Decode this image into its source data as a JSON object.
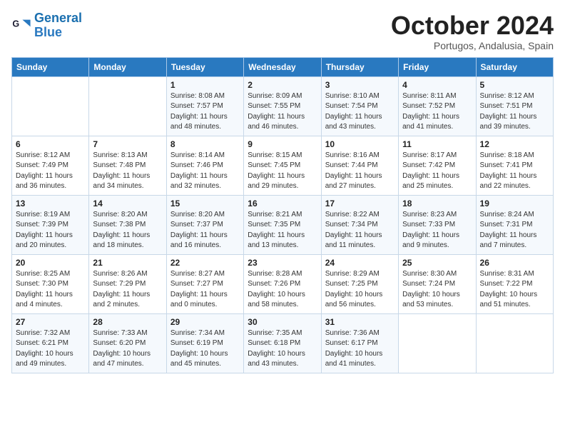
{
  "header": {
    "logo_line1": "General",
    "logo_line2": "Blue",
    "month_title": "October 2024",
    "location": "Portugos, Andalusia, Spain"
  },
  "weekdays": [
    "Sunday",
    "Monday",
    "Tuesday",
    "Wednesday",
    "Thursday",
    "Friday",
    "Saturday"
  ],
  "weeks": [
    [
      {
        "day": "",
        "sunrise": "",
        "sunset": "",
        "daylight": ""
      },
      {
        "day": "",
        "sunrise": "",
        "sunset": "",
        "daylight": ""
      },
      {
        "day": "1",
        "sunrise": "Sunrise: 8:08 AM",
        "sunset": "Sunset: 7:57 PM",
        "daylight": "Daylight: 11 hours and 48 minutes."
      },
      {
        "day": "2",
        "sunrise": "Sunrise: 8:09 AM",
        "sunset": "Sunset: 7:55 PM",
        "daylight": "Daylight: 11 hours and 46 minutes."
      },
      {
        "day": "3",
        "sunrise": "Sunrise: 8:10 AM",
        "sunset": "Sunset: 7:54 PM",
        "daylight": "Daylight: 11 hours and 43 minutes."
      },
      {
        "day": "4",
        "sunrise": "Sunrise: 8:11 AM",
        "sunset": "Sunset: 7:52 PM",
        "daylight": "Daylight: 11 hours and 41 minutes."
      },
      {
        "day": "5",
        "sunrise": "Sunrise: 8:12 AM",
        "sunset": "Sunset: 7:51 PM",
        "daylight": "Daylight: 11 hours and 39 minutes."
      }
    ],
    [
      {
        "day": "6",
        "sunrise": "Sunrise: 8:12 AM",
        "sunset": "Sunset: 7:49 PM",
        "daylight": "Daylight: 11 hours and 36 minutes."
      },
      {
        "day": "7",
        "sunrise": "Sunrise: 8:13 AM",
        "sunset": "Sunset: 7:48 PM",
        "daylight": "Daylight: 11 hours and 34 minutes."
      },
      {
        "day": "8",
        "sunrise": "Sunrise: 8:14 AM",
        "sunset": "Sunset: 7:46 PM",
        "daylight": "Daylight: 11 hours and 32 minutes."
      },
      {
        "day": "9",
        "sunrise": "Sunrise: 8:15 AM",
        "sunset": "Sunset: 7:45 PM",
        "daylight": "Daylight: 11 hours and 29 minutes."
      },
      {
        "day": "10",
        "sunrise": "Sunrise: 8:16 AM",
        "sunset": "Sunset: 7:44 PM",
        "daylight": "Daylight: 11 hours and 27 minutes."
      },
      {
        "day": "11",
        "sunrise": "Sunrise: 8:17 AM",
        "sunset": "Sunset: 7:42 PM",
        "daylight": "Daylight: 11 hours and 25 minutes."
      },
      {
        "day": "12",
        "sunrise": "Sunrise: 8:18 AM",
        "sunset": "Sunset: 7:41 PM",
        "daylight": "Daylight: 11 hours and 22 minutes."
      }
    ],
    [
      {
        "day": "13",
        "sunrise": "Sunrise: 8:19 AM",
        "sunset": "Sunset: 7:39 PM",
        "daylight": "Daylight: 11 hours and 20 minutes."
      },
      {
        "day": "14",
        "sunrise": "Sunrise: 8:20 AM",
        "sunset": "Sunset: 7:38 PM",
        "daylight": "Daylight: 11 hours and 18 minutes."
      },
      {
        "day": "15",
        "sunrise": "Sunrise: 8:20 AM",
        "sunset": "Sunset: 7:37 PM",
        "daylight": "Daylight: 11 hours and 16 minutes."
      },
      {
        "day": "16",
        "sunrise": "Sunrise: 8:21 AM",
        "sunset": "Sunset: 7:35 PM",
        "daylight": "Daylight: 11 hours and 13 minutes."
      },
      {
        "day": "17",
        "sunrise": "Sunrise: 8:22 AM",
        "sunset": "Sunset: 7:34 PM",
        "daylight": "Daylight: 11 hours and 11 minutes."
      },
      {
        "day": "18",
        "sunrise": "Sunrise: 8:23 AM",
        "sunset": "Sunset: 7:33 PM",
        "daylight": "Daylight: 11 hours and 9 minutes."
      },
      {
        "day": "19",
        "sunrise": "Sunrise: 8:24 AM",
        "sunset": "Sunset: 7:31 PM",
        "daylight": "Daylight: 11 hours and 7 minutes."
      }
    ],
    [
      {
        "day": "20",
        "sunrise": "Sunrise: 8:25 AM",
        "sunset": "Sunset: 7:30 PM",
        "daylight": "Daylight: 11 hours and 4 minutes."
      },
      {
        "day": "21",
        "sunrise": "Sunrise: 8:26 AM",
        "sunset": "Sunset: 7:29 PM",
        "daylight": "Daylight: 11 hours and 2 minutes."
      },
      {
        "day": "22",
        "sunrise": "Sunrise: 8:27 AM",
        "sunset": "Sunset: 7:27 PM",
        "daylight": "Daylight: 11 hours and 0 minutes."
      },
      {
        "day": "23",
        "sunrise": "Sunrise: 8:28 AM",
        "sunset": "Sunset: 7:26 PM",
        "daylight": "Daylight: 10 hours and 58 minutes."
      },
      {
        "day": "24",
        "sunrise": "Sunrise: 8:29 AM",
        "sunset": "Sunset: 7:25 PM",
        "daylight": "Daylight: 10 hours and 56 minutes."
      },
      {
        "day": "25",
        "sunrise": "Sunrise: 8:30 AM",
        "sunset": "Sunset: 7:24 PM",
        "daylight": "Daylight: 10 hours and 53 minutes."
      },
      {
        "day": "26",
        "sunrise": "Sunrise: 8:31 AM",
        "sunset": "Sunset: 7:22 PM",
        "daylight": "Daylight: 10 hours and 51 minutes."
      }
    ],
    [
      {
        "day": "27",
        "sunrise": "Sunrise: 7:32 AM",
        "sunset": "Sunset: 6:21 PM",
        "daylight": "Daylight: 10 hours and 49 minutes."
      },
      {
        "day": "28",
        "sunrise": "Sunrise: 7:33 AM",
        "sunset": "Sunset: 6:20 PM",
        "daylight": "Daylight: 10 hours and 47 minutes."
      },
      {
        "day": "29",
        "sunrise": "Sunrise: 7:34 AM",
        "sunset": "Sunset: 6:19 PM",
        "daylight": "Daylight: 10 hours and 45 minutes."
      },
      {
        "day": "30",
        "sunrise": "Sunrise: 7:35 AM",
        "sunset": "Sunset: 6:18 PM",
        "daylight": "Daylight: 10 hours and 43 minutes."
      },
      {
        "day": "31",
        "sunrise": "Sunrise: 7:36 AM",
        "sunset": "Sunset: 6:17 PM",
        "daylight": "Daylight: 10 hours and 41 minutes."
      },
      {
        "day": "",
        "sunrise": "",
        "sunset": "",
        "daylight": ""
      },
      {
        "day": "",
        "sunrise": "",
        "sunset": "",
        "daylight": ""
      }
    ]
  ]
}
